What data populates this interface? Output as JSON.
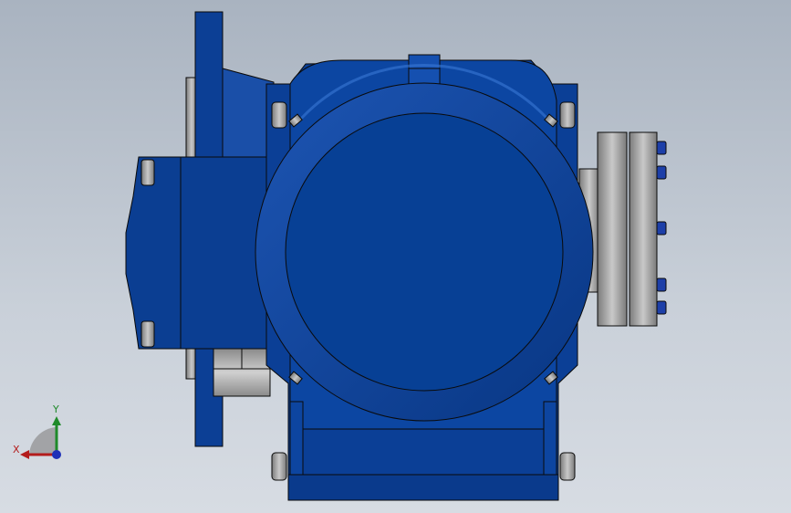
{
  "viewport": {
    "background_top": "#a9b3c0",
    "background_bottom": "#d7dce3"
  },
  "model": {
    "body_color": "#0a3f94",
    "body_dark": "#062b6b",
    "body_light": "#2560c0",
    "steel_color": "#9a9a9a",
    "outline_color": "#0a0a0a"
  },
  "triad": {
    "x_label": "X",
    "y_label": "Y",
    "x_color": "#b31c1c",
    "y_color": "#1f8a2a",
    "z_color": "#1d2fb8",
    "icon": "coordinate-triad-icon"
  }
}
